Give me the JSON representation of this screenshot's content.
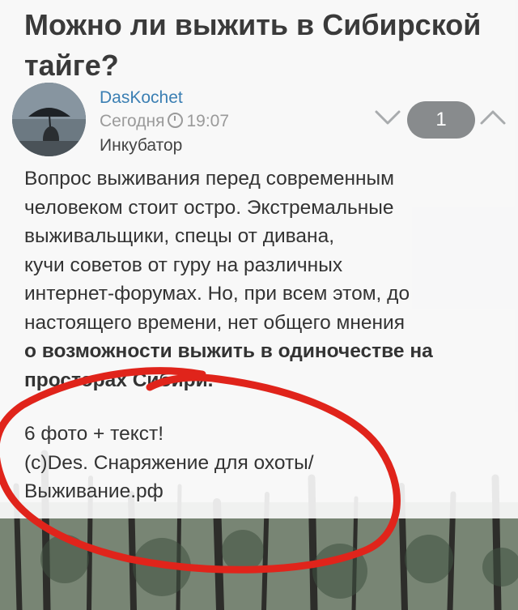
{
  "post": {
    "title": "Можно ли выжить в Сибирской тайге?",
    "author": "DasKochet",
    "date": "Сегодня",
    "time": "19:07",
    "community": "Инкубатор",
    "rating": "1",
    "body_lines": [
      "Вопрос выживания перед современным",
      "человеком стоит остро. Экстремальные",
      "выживальщики, спецы от дивана,",
      "кучи советов от гуру на различных",
      "интернет-форумах. Но, при всем этом, до",
      "настоящего времени, нет общего мнения"
    ],
    "bold_lines": [
      "о возможности выжить в одиночестве на",
      "просторах Сибири."
    ],
    "extra_lines": [
      "6 фото + текст!",
      "(c)Des. Снаряжение для охоты/",
      "Выживание.рф"
    ]
  },
  "icons": {
    "vote_down": "chevron-down-icon",
    "vote_up": "chevron-up-icon",
    "clock": "clock-icon"
  },
  "colors": {
    "author": "#3b7fb3",
    "rating_bg": "#888b8d",
    "annotation": "#e0241b"
  }
}
